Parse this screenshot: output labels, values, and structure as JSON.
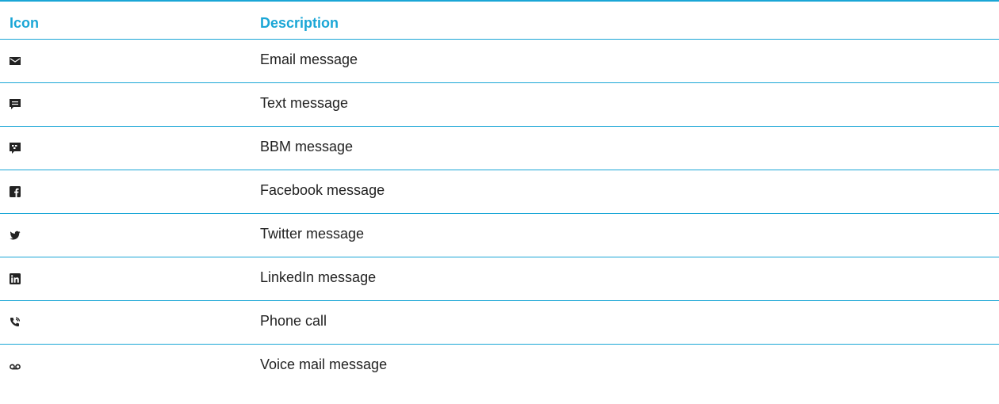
{
  "table": {
    "headers": {
      "icon": "Icon",
      "description": "Description"
    },
    "rows": [
      {
        "icon": "email-icon",
        "description": "Email message"
      },
      {
        "icon": "text-message-icon",
        "description": "Text message"
      },
      {
        "icon": "bbm-icon",
        "description": "BBM message"
      },
      {
        "icon": "facebook-icon",
        "description": "Facebook message"
      },
      {
        "icon": "twitter-icon",
        "description": "Twitter message"
      },
      {
        "icon": "linkedin-icon",
        "description": "LinkedIn message"
      },
      {
        "icon": "phone-call-icon",
        "description": "Phone call"
      },
      {
        "icon": "voicemail-icon",
        "description": "Voice mail message"
      }
    ]
  },
  "colors": {
    "accent": "#1aa6d6",
    "text": "#222222"
  }
}
